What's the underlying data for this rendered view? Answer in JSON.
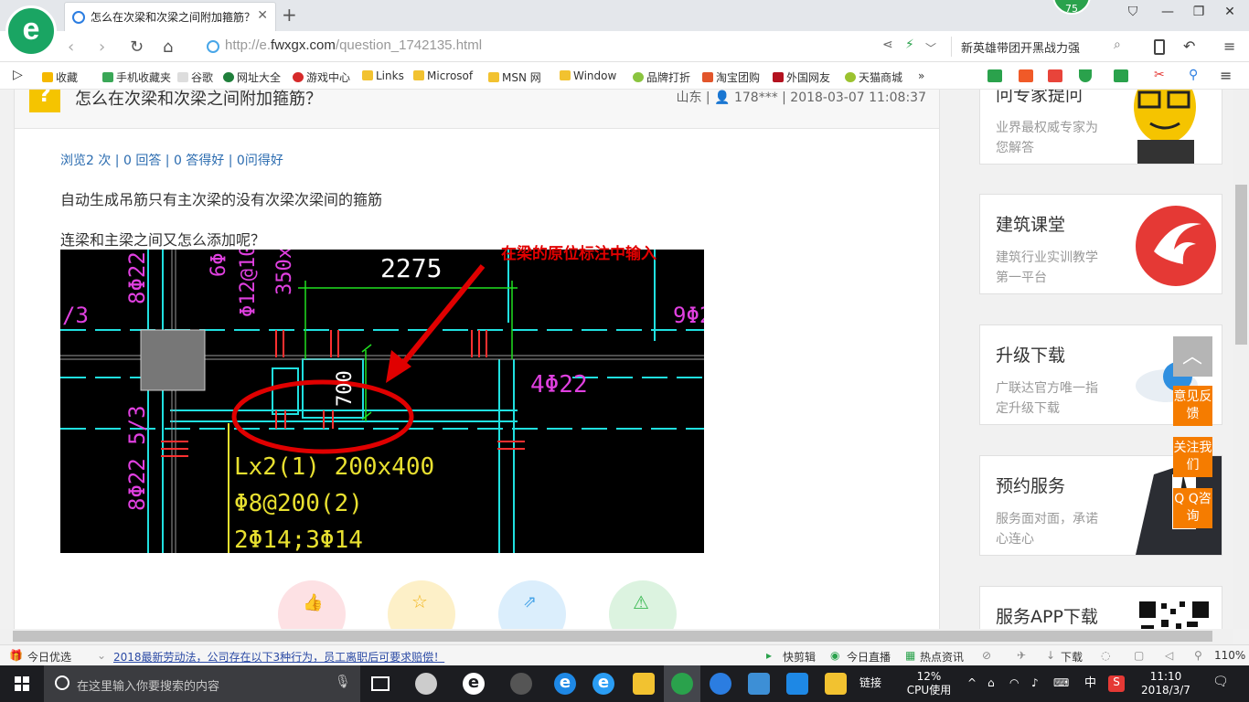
{
  "browser": {
    "tab_title": "怎么在次梁和次梁之间附加箍筋？",
    "url_prefix": "http://e.",
    "url_host": "fwxgx.com",
    "url_path": "/question_1742135.html",
    "search_text": "新英雄带团开黑战力强",
    "badge": "75",
    "logo_letter": "e"
  },
  "bookmarks": [
    "收藏",
    "手机收藏夹",
    "谷歌",
    "网址大全",
    "游戏中心",
    "Links",
    "Microsof",
    "MSN 网",
    "Window",
    "品牌打折",
    "淘宝团购",
    "外国网友",
    "天猫商城"
  ],
  "question": {
    "title": "怎么在次梁和次梁之间附加箍筋？",
    "meta": "山东 | 👤 178*** | 2018-03-07 11:08:37",
    "stats": "浏览2 次 | 0 回答 | 0 答得好 | 0问得好",
    "line1": "自动生成吊筋只有主次梁的没有次梁次梁间的箍筋",
    "line2": "连梁和主梁之间又怎么添加呢？",
    "annotation": "在梁的原位标注中输入",
    "cad_texts": {
      "t1": "2275",
      "t2": "8Φ22",
      "t3": "6Φ",
      "t4": "Φ12@10",
      "t5": "350x",
      "t6": "/3",
      "t7": "9Φ2",
      "t8": "4Φ22",
      "t9": "700",
      "t10": "8Φ22 5/3",
      "t11": "Lx2(1) 200x400",
      "t12": "Φ8@200(2)",
      "t13": "2Φ14;3Φ14"
    }
  },
  "sidebar": [
    {
      "title": "问专家提问",
      "desc": "业界最权威专家为您解答"
    },
    {
      "title": "建筑课堂",
      "desc": "建筑行业实训教学第一平台"
    },
    {
      "title": "升级下载",
      "desc": "广联达官方唯一指定升级下载"
    },
    {
      "title": "预约服务",
      "desc": "服务面对面，承诺心连心"
    },
    {
      "title": "服务APP下载",
      "desc": ""
    }
  ],
  "float_buttons": [
    "意见反馈",
    "关注我们",
    "Q Q咨询"
  ],
  "statusbar": {
    "left": "今日优选",
    "news": "2018最新劳动法，公司存在以下3种行为，员工离职后可要求赔偿！",
    "items": [
      "快剪辑",
      "今日直播",
      "热点资讯",
      "下载"
    ],
    "zoom": "110%"
  },
  "taskbar": {
    "search_placeholder": "在这里输入你要搜索的内容",
    "links": "链接",
    "cpu_pct": "12%",
    "cpu_label": "CPU使用",
    "ime": "中",
    "time": "11:10",
    "date": "2018/3/7"
  }
}
